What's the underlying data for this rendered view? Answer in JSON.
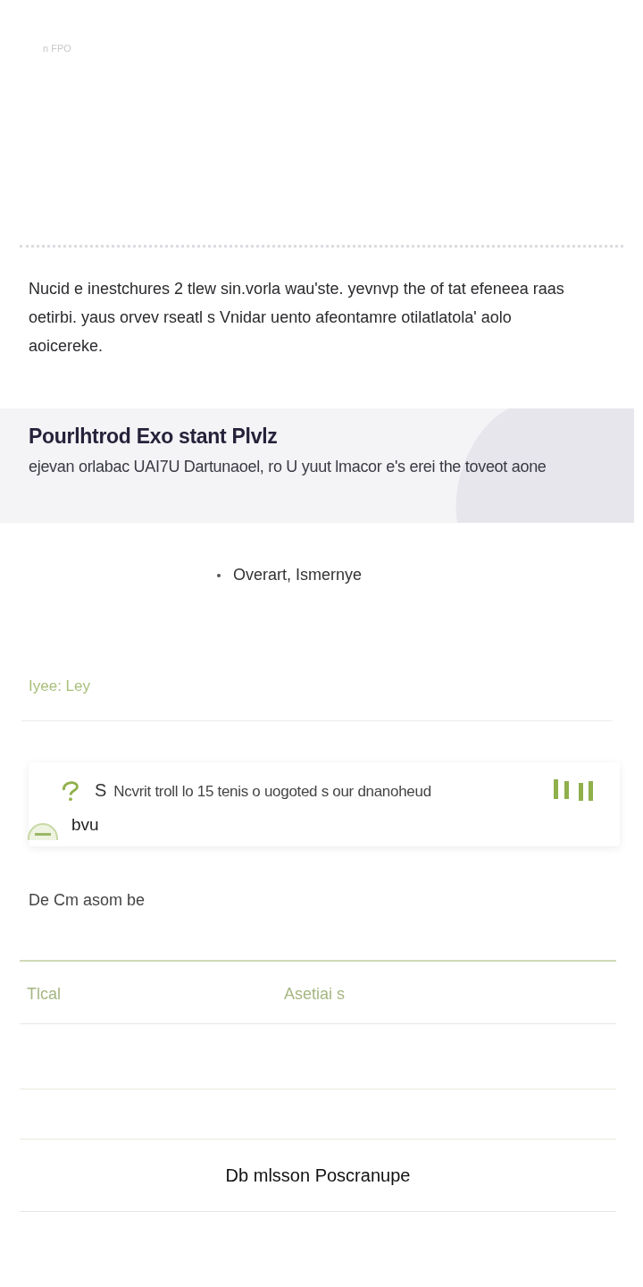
{
  "header": {
    "mark": "n FPO"
  },
  "intro": "Nucid e inestchures 2 tlew sin.vorla wau'ste. yevnvp the of tat efeneea raas oetirbi. yaus orvev rseatl s Vnidar uento afeontamre otilatlatola' aolo aoicereke.",
  "banner": {
    "title": "Pourlhtrod Exo stant Plvlz",
    "subtitle": "ejevan orlabac UAI7U Dartunaoel, ro U yuut lmacor e's erei the tovеot aone"
  },
  "bullet": "Overart, Ismernye",
  "section_label": "Iyee: Ley",
  "notice": {
    "lead": "S",
    "text": "Ncvrit troll lo 15 tenis o uogoted s our dnanoheud",
    "continuation": "bvu"
  },
  "caption": "De Cm asom be",
  "table": {
    "columns": [
      "Tlcal",
      "Asetiai s"
    ],
    "rows": [
      [],
      []
    ]
  },
  "footer_link": "Db mlsson Poscranupe"
}
